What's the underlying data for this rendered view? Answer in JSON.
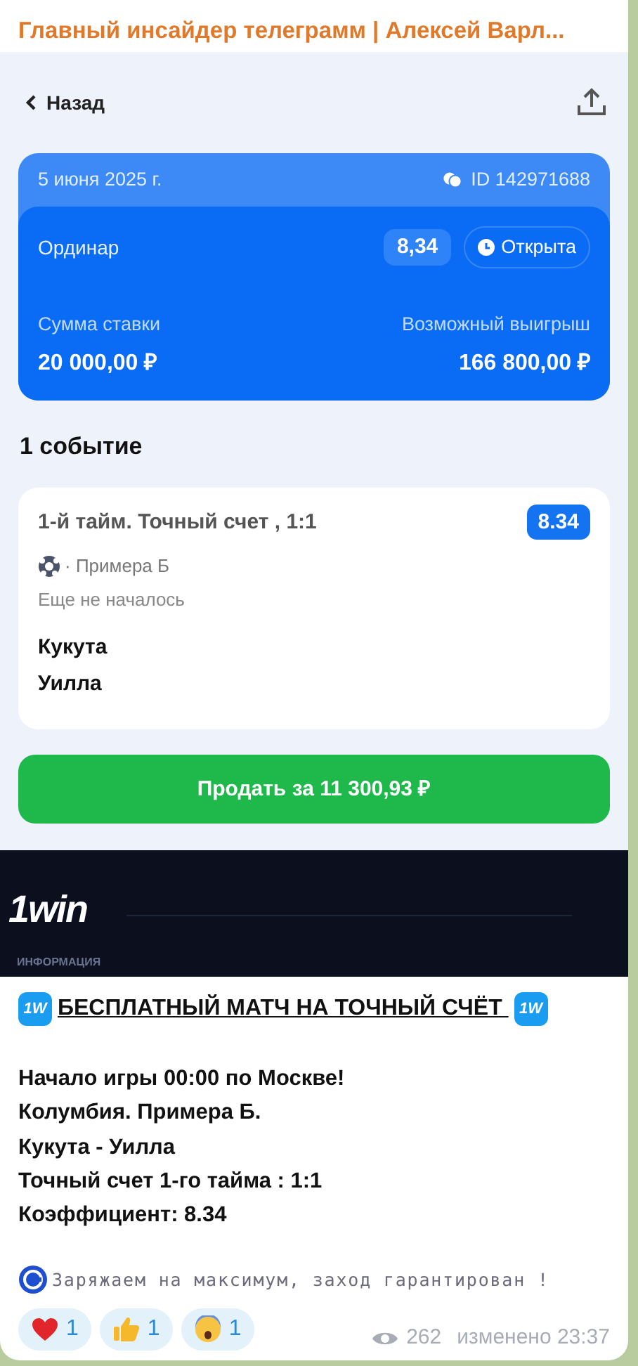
{
  "channel_title": "Главный инсайдер телеграмм | Алексей Варл...",
  "bet_screen": {
    "back_label": "Назад",
    "date": "5 июня 2025 г.",
    "bet_id": "ID 142971688",
    "bet_type": "Ординар",
    "odds": "8,34",
    "status": "Открыта",
    "stake_label": "Сумма ставки",
    "stake": "20 000,00 ₽",
    "payout_label": "Возможный выигрыш",
    "payout": "166 800,00 ₽",
    "events_heading": "1 событие",
    "event": {
      "market": "1-й тайм. Точный счет , 1:1",
      "odds": "8.34",
      "league": "· Примера Б",
      "state": "Еще не началось",
      "teams": [
        "Кукута",
        "Уилла"
      ]
    },
    "sell_button": "Продать за 11 300,93 ₽"
  },
  "banner": {
    "logo": "1win",
    "caption": "ИНФОРМАЦИЯ"
  },
  "message": {
    "headline": {
      "leading_badge": "1W",
      "text": "БЕСПЛАТНЫЙ МАТЧ НА ТОЧНЫЙ СЧЁТ ",
      "trailing_badge": "1W"
    },
    "lines": [
      "Начало игры 00:00 по Москве!",
      "Колумбия. Примера Б.",
      "Кукута - Уилла",
      "Точный счет 1-го тайма : 1:1",
      "Коэффициент: 8.34"
    ],
    "signature": "Заряжаем на максимум, заход гарантирован !",
    "reactions": [
      {
        "kind": "heart",
        "count": "1"
      },
      {
        "kind": "thumbs_up",
        "count": "1"
      },
      {
        "kind": "scream",
        "count": "1"
      }
    ],
    "views": "262",
    "edited": "изменено 23:37"
  }
}
